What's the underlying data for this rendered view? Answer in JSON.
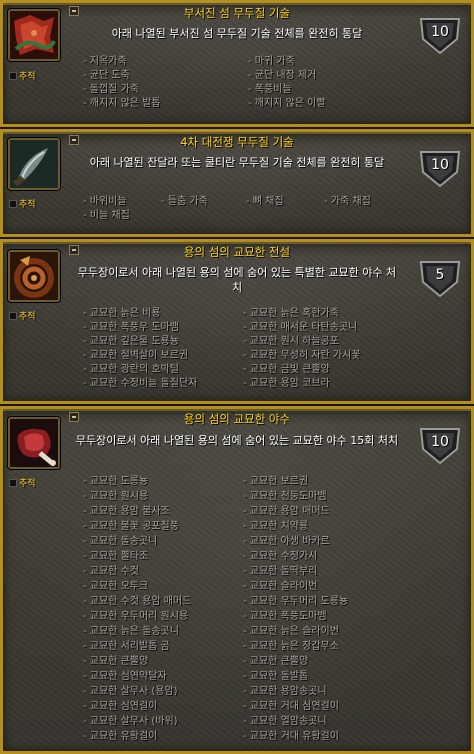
{
  "common": {
    "track_label": "추적"
  },
  "achievements": [
    {
      "title": "부서진 섬 무두질 기술",
      "description": "아래 나열된 부서진 섬 무두질 기술 전체를 완전히 통달",
      "points": "10",
      "icon": "leather-hide-red-icon",
      "criteria": [
        "- 지옥가죽",
        "- 마귀 가죽",
        "- 균단 도축",
        "- 균단 내장 제거",
        "- 돌껍질 가죽",
        "- 폭풍비늘",
        "- 깨지지 않은 발톱",
        "- 깨지지 않은 이빨"
      ]
    },
    {
      "title": "4차 대전쟁 무두질 기술",
      "description": "아래 나열된 잔달라 또는 쿨티란 무두질 기술 전체를 완전히 통달",
      "points": "10",
      "icon": "skinning-knife-icon",
      "criteria": [
        "- 바위비늘",
        "- 들춤 가죽",
        "- 뼈 채집",
        "- 가죽 채집",
        "- 비늘 채집"
      ]
    },
    {
      "title": "용의 섬의 교묘한 전설",
      "description": "무두장이로서 아래 나열된 용의 섬에 숨어 있는 특별한 교묘한 야수 처치",
      "points": "5",
      "icon": "coiled-hide-icon",
      "criteria": [
        "- 교묘한 늙은 비룡",
        "- 교묘한 늙은 혹한가죽",
        "- 교묘한 폭풍우 도마뱀",
        "- 교묘한 매서운 타탄송곳니",
        "- 교묘한 깊은물 도룡뇽",
        "- 교묘한 원시 하늘공포",
        "- 교묘한 절벽살이 보르권",
        "- 교묘한 무성히 자란 가시꽃",
        "- 교묘한 광란의 호박털",
        "- 교묘한 금빛 큰뿔양",
        "- 교묘한 수정비늘 돌질단자",
        "- 교묘한 용암 코브라"
      ]
    },
    {
      "title": "용의 섬의 교묘한 야수",
      "description": "무두장이로서 아래 나열된 용의 섬에 숨어 있는 교묘한 야수 15회 처치",
      "points": "10",
      "icon": "raw-meat-icon",
      "criteria": [
        "- 교묘한 도롱뇽",
        "- 교묘한 보르권",
        "- 교묘한 원시용",
        "- 교묘한 천둥도마뱀",
        "- 교묘한 용암 불사조",
        "- 교묘한 용암 매머드",
        "- 교묘한 불꽃 공포질풍",
        "- 교묘한 치약룡",
        "- 교묘한 돌송곳니",
        "- 교묘한 야생 바카르",
        "- 교묘한 뿔타조",
        "- 교묘한 수정가시",
        "- 교묘한 수컷",
        "- 교묘한 돌딱부리",
        "- 교묘한 오투크",
        "- 교묘한 슬라이번",
        "- 교묘한 수컷 용암 매머드",
        "- 교묘한 우두머리 도룡뇽",
        "- 교묘한 우두머리 원시용",
        "- 교묘한 폭풍도마뱀",
        "- 교묘한 늙은 돌송곳니",
        "- 교묘한 늙은 슬라이번",
        "- 교묘한 서리발톱 곰",
        "- 교묘한 늙은 장갑무소",
        "- 교묘한 큰뿔양",
        "- 교묘한 큰뿔양",
        "- 교묘한 심연약탈자",
        "- 교묘한 돌발톱",
        "- 교묘한 살무사 (용암)",
        "- 교묘한 용암송곳니",
        "- 교묘한 심연걸이",
        "- 교묘한 거대 심연걸이",
        "- 교묘한 살무사 (바위)",
        "- 교묘한 열암송곳니",
        "- 교묘한 유황걸이",
        "- 교묘한 거대 유황걸이"
      ]
    }
  ]
}
